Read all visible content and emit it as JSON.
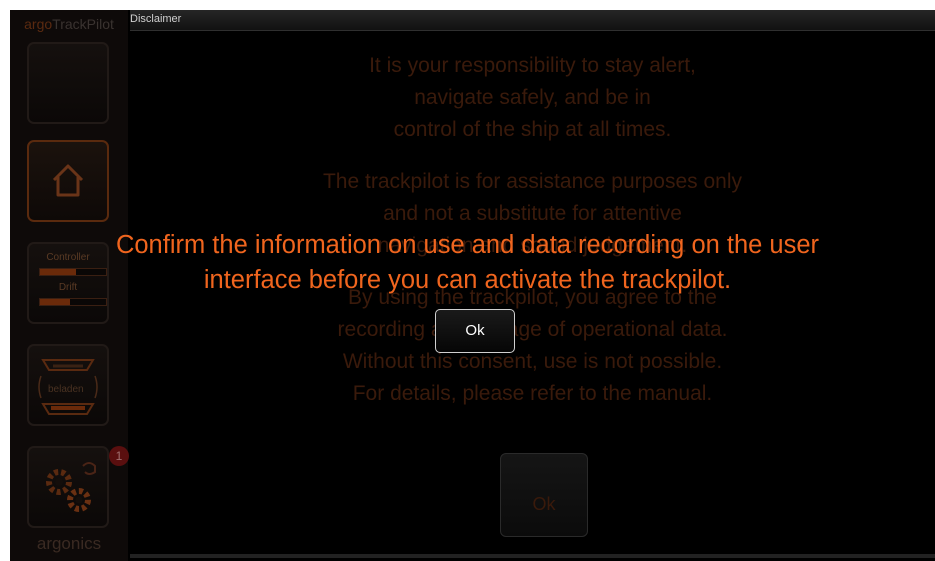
{
  "sidebar": {
    "brand_prefix": "argo",
    "brand_suffix": "TrackPilot",
    "controller_label": "Controller",
    "controller_level": 0.55,
    "drift_label": "Drift",
    "drift_level": 0.45,
    "load_label": "beladen",
    "notification_count": "1",
    "footer_brand": "argonics"
  },
  "dialog": {
    "title": "Disclaimer",
    "paragraph1": [
      "It is your responsibility to stay alert,",
      "navigate safely, and be in",
      "control of the ship at all times."
    ],
    "paragraph2": [
      "The trackpilot is for assistance purposes only",
      "and not a substitute for attentive",
      "navigation and sound judgement."
    ],
    "paragraph3": [
      "By using the trackpilot, you agree to the",
      "recording and storage of operational data.",
      "Without this consent, use is not possible.",
      "For details, please refer to the manual."
    ],
    "ok_label": "Ok"
  },
  "overlay": {
    "message_lines": [
      "Confirm the information on use and data recording on the user",
      "interface before you can activate the trackpilot."
    ],
    "ok_label": "Ok"
  },
  "colors": {
    "accent": "#f0651e",
    "dim_text": "#3a1a0b",
    "background": "#000000"
  }
}
